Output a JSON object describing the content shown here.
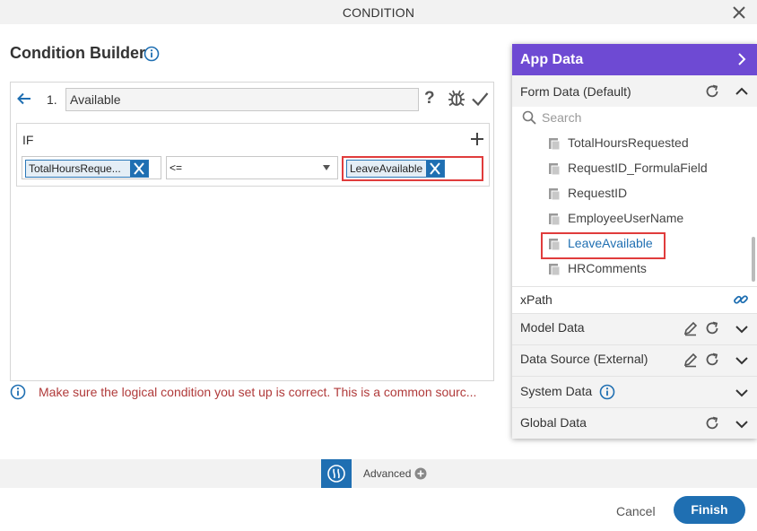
{
  "dialog": {
    "title": "CONDITION"
  },
  "builder": {
    "title": "Condition Builder",
    "condition_number": "1.",
    "condition_name": "Available",
    "help_glyph": "?",
    "if_label": "IF",
    "left_operand": "TotalHoursReque...",
    "operator": "<=",
    "right_operand": "LeaveAvailable",
    "warning": "Make sure the logical condition you set up is correct. This is a common sourc..."
  },
  "app_data": {
    "title": "App Data",
    "form_data_label": "Form Data (Default)",
    "search_placeholder": "Search",
    "fields": [
      {
        "name": "TotalHoursRequested"
      },
      {
        "name": "RequestID_FormulaField"
      },
      {
        "name": "RequestID"
      },
      {
        "name": "EmployeeUserName"
      },
      {
        "name": "LeaveAvailable"
      },
      {
        "name": "HRComments"
      }
    ],
    "xpath_label": "xPath",
    "model_data_label": "Model Data",
    "data_source_label": "Data Source (External)",
    "system_data_label": "System Data",
    "global_data_label": "Global Data"
  },
  "footer": {
    "advanced_label": "Advanced",
    "cancel_label": "Cancel",
    "finish_label": "Finish"
  },
  "colors": {
    "accent_blue": "#1f6fb2",
    "app_data_header": "#6e4ad3",
    "highlight_red": "#e03c3c",
    "warning_text": "#b03a3a",
    "selected_field": "#1f6fb2"
  },
  "icons": [
    "close-icon",
    "info-icon",
    "back-arrow-icon",
    "help-icon",
    "bug-icon",
    "check-icon",
    "plus-icon",
    "remove-icon",
    "chevron-right-icon",
    "refresh-icon",
    "chevron-up-icon",
    "chevron-down-icon",
    "search-icon",
    "field-icon",
    "link-icon",
    "edit-icon",
    "advanced-icon",
    "plus-circle-icon"
  ]
}
